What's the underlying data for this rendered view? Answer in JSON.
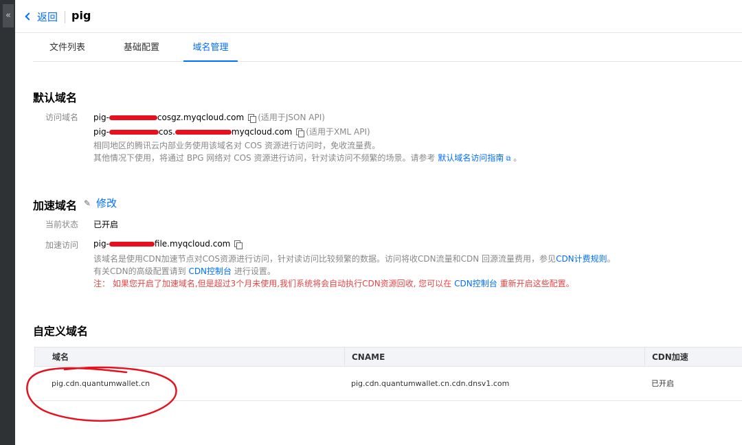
{
  "sidebar": {
    "collapse_glyph": "«"
  },
  "header": {
    "back_label": "返回",
    "title": "pig"
  },
  "tabs": [
    {
      "label": "文件列表",
      "active": false
    },
    {
      "label": "基础配置",
      "active": false
    },
    {
      "label": "域名管理",
      "active": true
    }
  ],
  "default_domain": {
    "title": "默认域名",
    "access_label": "访问域名",
    "domain_json": {
      "prefix": "pig-",
      "suffix": "cosgz.myqcloud.com",
      "note": "(适用于JSON API)"
    },
    "domain_xml": {
      "prefix": "pig-",
      "mid": "cos.",
      "suffix": "myqcloud.com",
      "note": "(适用于XML API)"
    },
    "hint1": "相同地区的腾讯云内部业务使用该域名对 COS 资源进行访问时，免收流量费。",
    "hint2_prefix": "其他情况下使用，将通过 BPG 网络对 COS 资源进行访问，针对读访问不频繁的场景。请参考",
    "guide_link": "默认域名访问指南",
    "hint2_suffix": "。"
  },
  "accel_domain": {
    "title": "加速域名",
    "edit_label": "修改",
    "status_label": "当前状态",
    "status_value": "已开启",
    "access_label": "加速访问",
    "domain": {
      "prefix": "pig-",
      "suffix": "file.myqcloud.com"
    },
    "hint1_prefix": "该域名是使用CDN加速节点对COS资源进行访问，针对读访问比较频繁的数据。访问将收CDN流量和CDN 回源流量费用，参见",
    "billing_link": "CDN计费规则",
    "hint1_suffix": "。",
    "hint2_prefix": "有关CDN的高级配置请到",
    "console_link": "CDN控制台",
    "hint2_suffix": "进行设置。",
    "warn_prefix": "注：  如果您开启了加速域名,但是超过3个月未使用,我们系统将会自动执行CDN资源回收, 您可以在",
    "warn_link": "CDN控制台",
    "warn_suffix": "重新开启这些配置。"
  },
  "custom_domain": {
    "title": "自定义域名",
    "columns": [
      "域名",
      "CNAME",
      "CDN加速"
    ],
    "rows": [
      {
        "domain": "pig.cdn.quantumwallet.cn",
        "cname": "pig.cdn.quantumwallet.cn.cdn.dnsv1.com",
        "cdn": "已开启"
      }
    ]
  },
  "colors": {
    "accent": "#006eff",
    "redaction": "#e8101c",
    "warning": "#e54545"
  }
}
